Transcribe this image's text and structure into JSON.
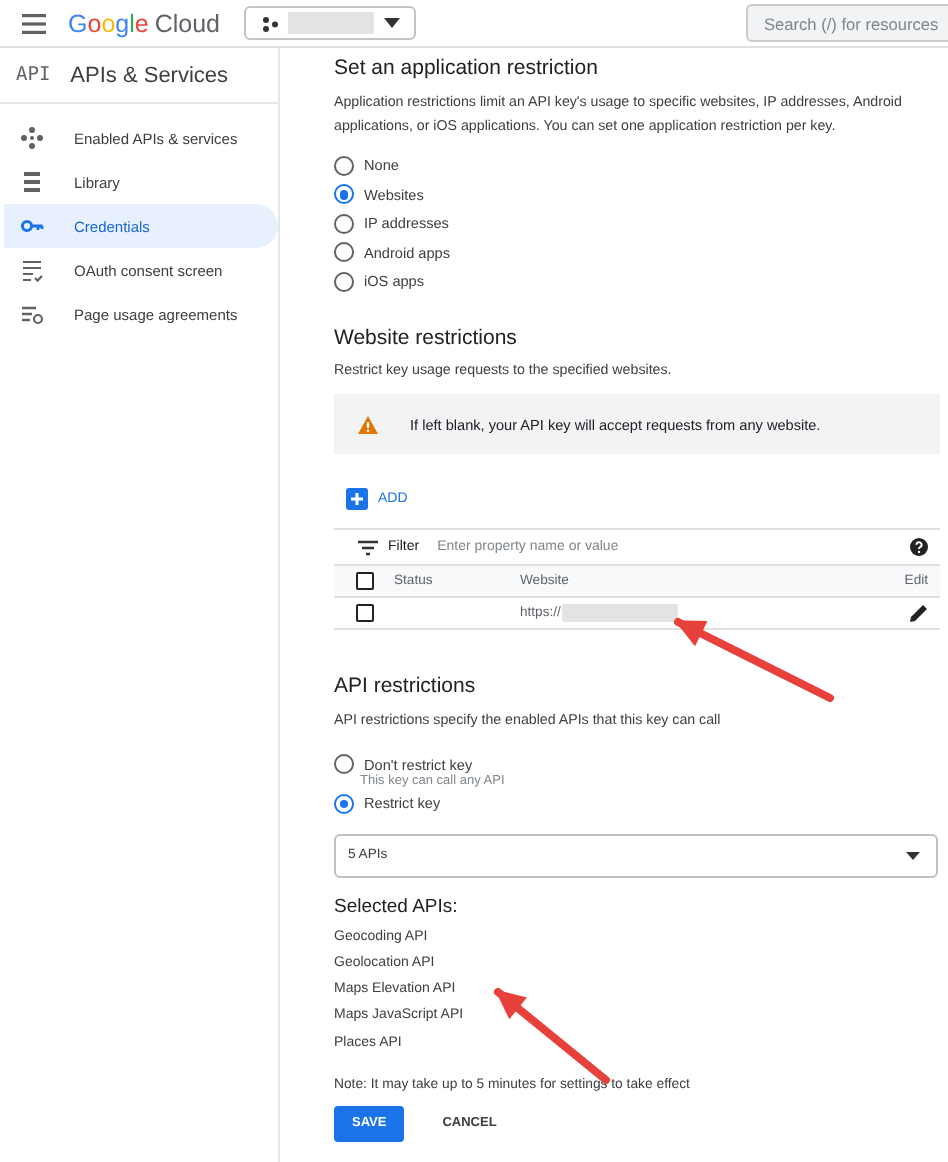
{
  "top_bar": {
    "logo_brand": "Google",
    "logo_product": "Cloud",
    "search": {
      "placeholder": "Search (/) for resources"
    }
  },
  "sidebar": {
    "header_badge": "API",
    "title": "APIs & Services",
    "items": [
      {
        "label": "Enabled APIs & services",
        "kind": "nodes",
        "selected": false
      },
      {
        "label": "Library",
        "kind": "library",
        "selected": false
      },
      {
        "label": "Credentials",
        "kind": "key",
        "selected": true
      },
      {
        "label": "OAuth consent screen",
        "kind": "consent",
        "selected": false
      },
      {
        "label": "Page usage agreements",
        "kind": "agreements",
        "selected": false
      }
    ]
  },
  "application_restriction": {
    "title": "Set an application restriction",
    "description": "Application restrictions limit an API key's usage to specific websites, IP addresses, Android applications, or iOS applications. You can set one application restriction per key.",
    "options": [
      {
        "label": "None",
        "selected": false
      },
      {
        "label": "Websites",
        "selected": true
      },
      {
        "label": "IP addresses",
        "selected": false
      },
      {
        "label": "Android apps",
        "selected": false
      },
      {
        "label": "iOS apps",
        "selected": false
      }
    ]
  },
  "website_restrictions": {
    "title": "Website restrictions",
    "description": "Restrict key usage requests to the specified websites.",
    "warning": "If left blank, your API key will accept requests from any website.",
    "add_label": "ADD",
    "filter_label": "Filter",
    "filter_placeholder": "Enter property name or value",
    "table": {
      "columns": [
        "Status",
        "Website",
        "Edit"
      ],
      "header_checked": false,
      "rows": [
        {
          "checked": false,
          "website": "https://"
        }
      ]
    }
  },
  "api_restrictions": {
    "title": "API restrictions",
    "description": "API restrictions specify the enabled APIs that this key can call",
    "options": [
      {
        "label": "Don't restrict key",
        "hint": "This key can call any API",
        "selected": false
      },
      {
        "label": "Restrict key",
        "selected": true
      }
    ],
    "dropdown_value": "5 APIs",
    "selected_title": "Selected APIs:",
    "selected_apis": [
      "Geocoding API",
      "Geolocation API",
      "Maps Elevation API",
      "Maps JavaScript API",
      "Places API"
    ]
  },
  "note": "Note: It may take up to 5 minutes for settings to take effect",
  "buttons": [
    {
      "label": "SAVE",
      "kind": "primary"
    },
    {
      "label": "CANCEL",
      "kind": "text"
    }
  ]
}
